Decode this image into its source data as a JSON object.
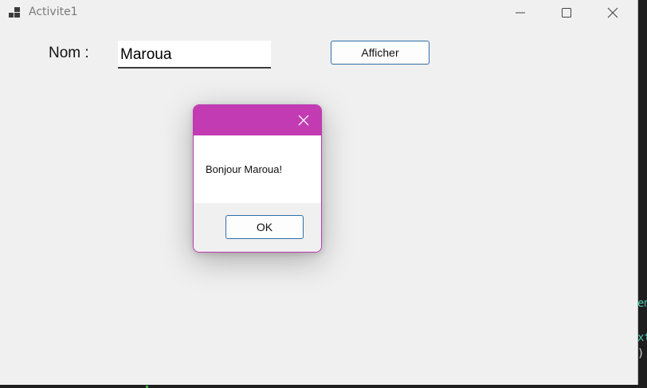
{
  "window": {
    "title": "Activite1"
  },
  "form": {
    "nom_label": "Nom :",
    "nom_value": "Maroua",
    "afficher_label": "Afficher"
  },
  "messagebox": {
    "message": "Bonjour Maroua!",
    "ok_label": "OK",
    "accent_color": "#c23bb2"
  },
  "background_code": {
    "line1": "em",
    "line2": "xt",
    "line3": ")"
  },
  "icons": [
    "app-icon",
    "minimize-icon",
    "maximize-icon",
    "close-icon",
    "dialog-close-icon"
  ]
}
